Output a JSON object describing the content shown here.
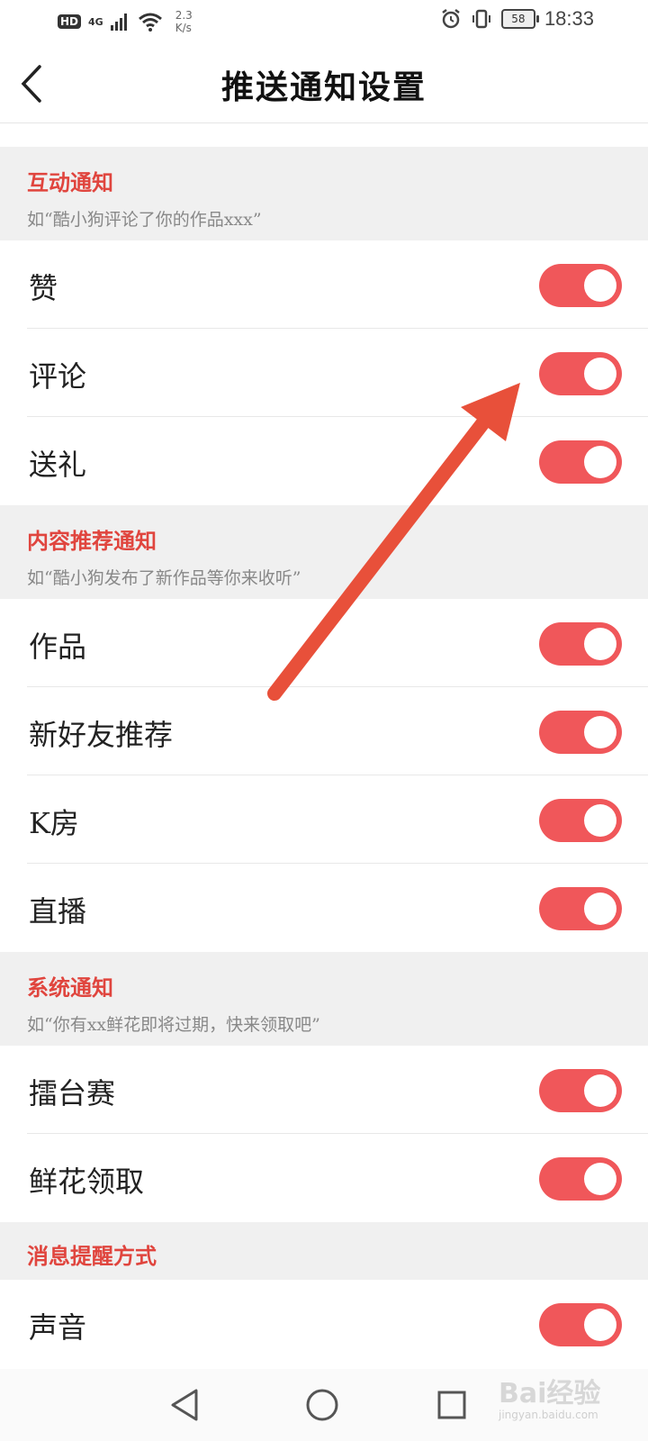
{
  "status_bar": {
    "hd": "HD",
    "network": "4G",
    "net_speed_value": "2.3",
    "net_speed_unit": "K/s",
    "battery": "58",
    "time": "18:33"
  },
  "header": {
    "title": "推送通知设置"
  },
  "sections": [
    {
      "title": "互动通知",
      "desc": "如“酷小狗评论了你的作品xxx”",
      "items": [
        {
          "label": "赞",
          "on": true
        },
        {
          "label": "评论",
          "on": true
        },
        {
          "label": "送礼",
          "on": true
        }
      ]
    },
    {
      "title": "内容推荐通知",
      "desc": "如“酷小狗发布了新作品等你来收听”",
      "items": [
        {
          "label": "作品",
          "on": true
        },
        {
          "label": "新好友推荐",
          "on": true
        },
        {
          "label": "K房",
          "on": true
        },
        {
          "label": "直播",
          "on": true
        }
      ]
    },
    {
      "title": "系统通知",
      "desc": "如“你有xx鲜花即将过期，快来领取吧”",
      "items": [
        {
          "label": "擂台赛",
          "on": true
        },
        {
          "label": "鲜花领取",
          "on": true
        }
      ]
    },
    {
      "title": "消息提醒方式",
      "desc": "",
      "items": [
        {
          "label": "声音",
          "on": true
        }
      ]
    }
  ],
  "watermark": {
    "text": "Bai经验",
    "sub": "jingyan.baidu.com"
  },
  "colors": {
    "accent": "#e0453e",
    "toggle_on": "#f0575a",
    "arrow": "#e8503a"
  }
}
